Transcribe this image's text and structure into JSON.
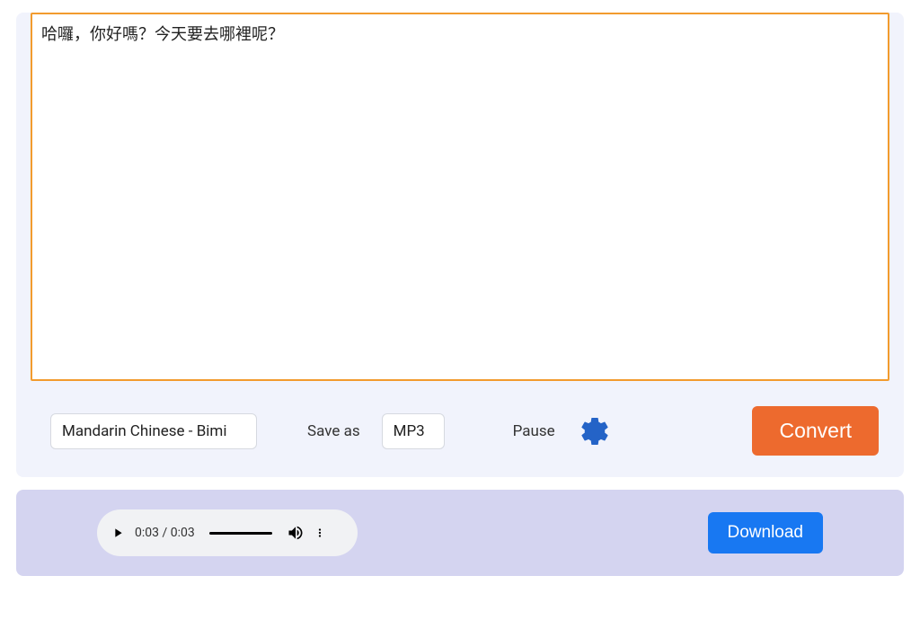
{
  "textarea": {
    "value": "哈囉，你好嗎？今天要去哪裡呢？"
  },
  "controls": {
    "voice_selected": "Mandarin Chinese - Bimi",
    "save_as_label": "Save as",
    "format_selected": "MP3",
    "pause_label": "Pause",
    "convert_label": "Convert"
  },
  "audio": {
    "current_time": "0:03",
    "total_time": "0:03",
    "download_label": "Download"
  }
}
